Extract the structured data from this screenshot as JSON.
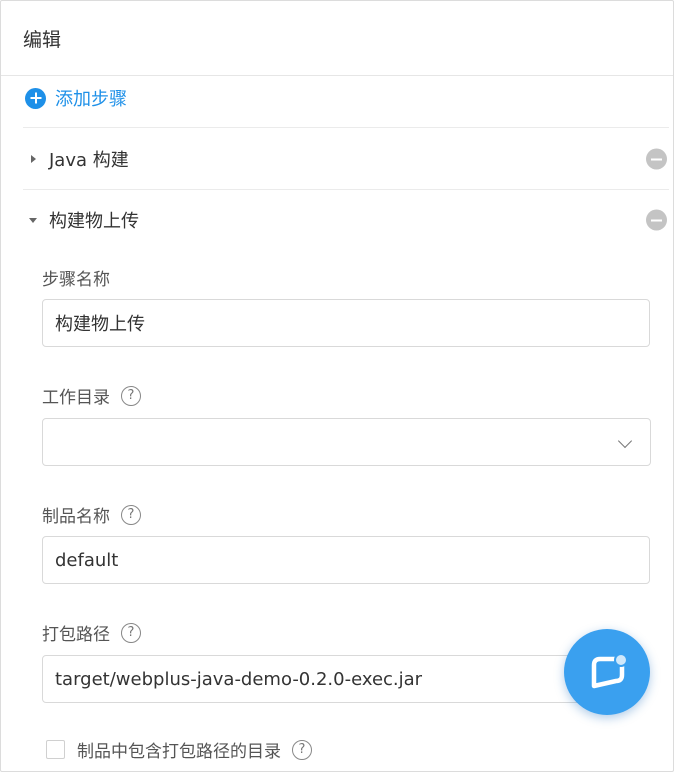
{
  "header": {
    "title": "编辑"
  },
  "add_step": {
    "label": "添加步骤"
  },
  "steps": [
    {
      "title": "Java 构建",
      "expanded": false
    },
    {
      "title": "构建物上传",
      "expanded": true
    }
  ],
  "form": {
    "step_name": {
      "label": "步骤名称",
      "value": "构建物上传"
    },
    "work_dir": {
      "label": "工作目录",
      "value": ""
    },
    "artifact_name": {
      "label": "制品名称",
      "value": "default"
    },
    "package_path": {
      "label": "打包路径",
      "value": "target/webplus-java-demo-0.2.0-exec.jar"
    },
    "include_dir": {
      "label": "制品中包含打包路径的目录",
      "checked": false
    }
  },
  "help_icon_glyph": "?",
  "icons": {
    "add": "plus-circle-icon",
    "remove": "minus-circle-icon",
    "help": "question-circle-icon",
    "chat": "chat-bubble-icon"
  },
  "colors": {
    "accent": "#1e90e8",
    "fab": "#3aa0ef",
    "remove": "#c4c4c4"
  }
}
